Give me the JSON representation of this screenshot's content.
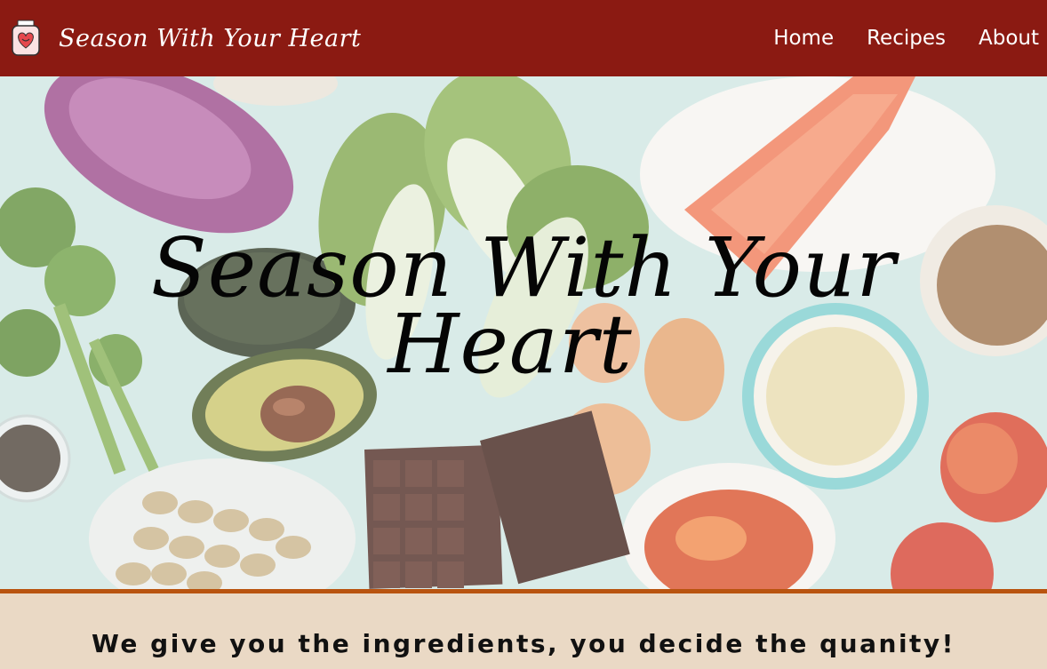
{
  "header": {
    "brand_name": "Season With Your Heart",
    "logo_icon": "heart-jar-icon",
    "background_color": "#8b1a12"
  },
  "nav": {
    "items": [
      {
        "label": "Home"
      },
      {
        "label": "Recipes"
      },
      {
        "label": "About"
      }
    ]
  },
  "hero": {
    "title_line1": "Season With Your",
    "title_line2": "Heart",
    "image_subject": "fresh-ingredients-flatlay"
  },
  "tagline": {
    "text": "We give you the ingredients, you decide the quanity!",
    "background_color": "#ead9c5",
    "accent_color": "#b9540f"
  }
}
